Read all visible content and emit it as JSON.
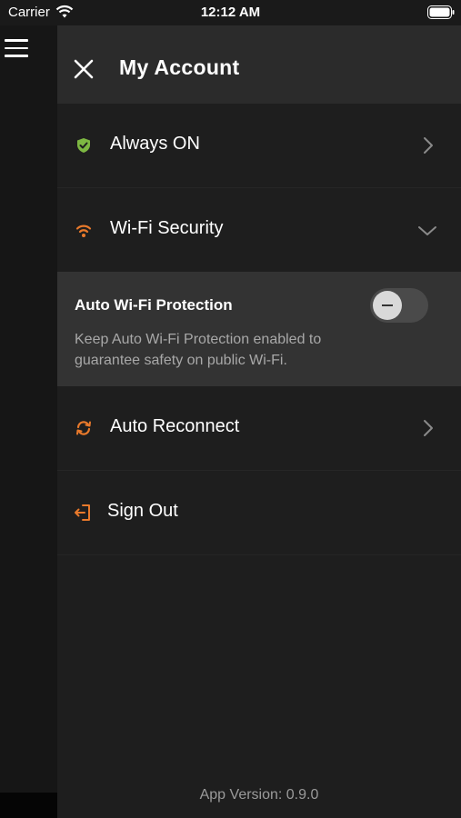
{
  "status_bar": {
    "carrier": "Carrier",
    "time": "12:12 AM"
  },
  "drawer": {
    "title": "My Account",
    "items": [
      {
        "label": "Always ON",
        "icon": "shield-check-icon",
        "trailing": "chevron-right-icon"
      },
      {
        "label": "Wi-Fi Security",
        "icon": "wifi-icon",
        "trailing": "chevron-down-icon"
      },
      {
        "label": "Auto Reconnect",
        "icon": "sync-icon",
        "trailing": "chevron-right-icon"
      },
      {
        "label": "Sign Out",
        "icon": "sign-out-icon"
      }
    ],
    "wifi_protection": {
      "title": "Auto Wi-Fi Protection",
      "description": "Keep Auto Wi-Fi Protection enabled to guarantee safety on public Wi-Fi.",
      "enabled": false
    },
    "version": "App Version: 0.9.0"
  },
  "colors": {
    "accent": "#e8792b",
    "shield": "#7db742",
    "panel": "#333333",
    "header": "#2b2b2b"
  }
}
